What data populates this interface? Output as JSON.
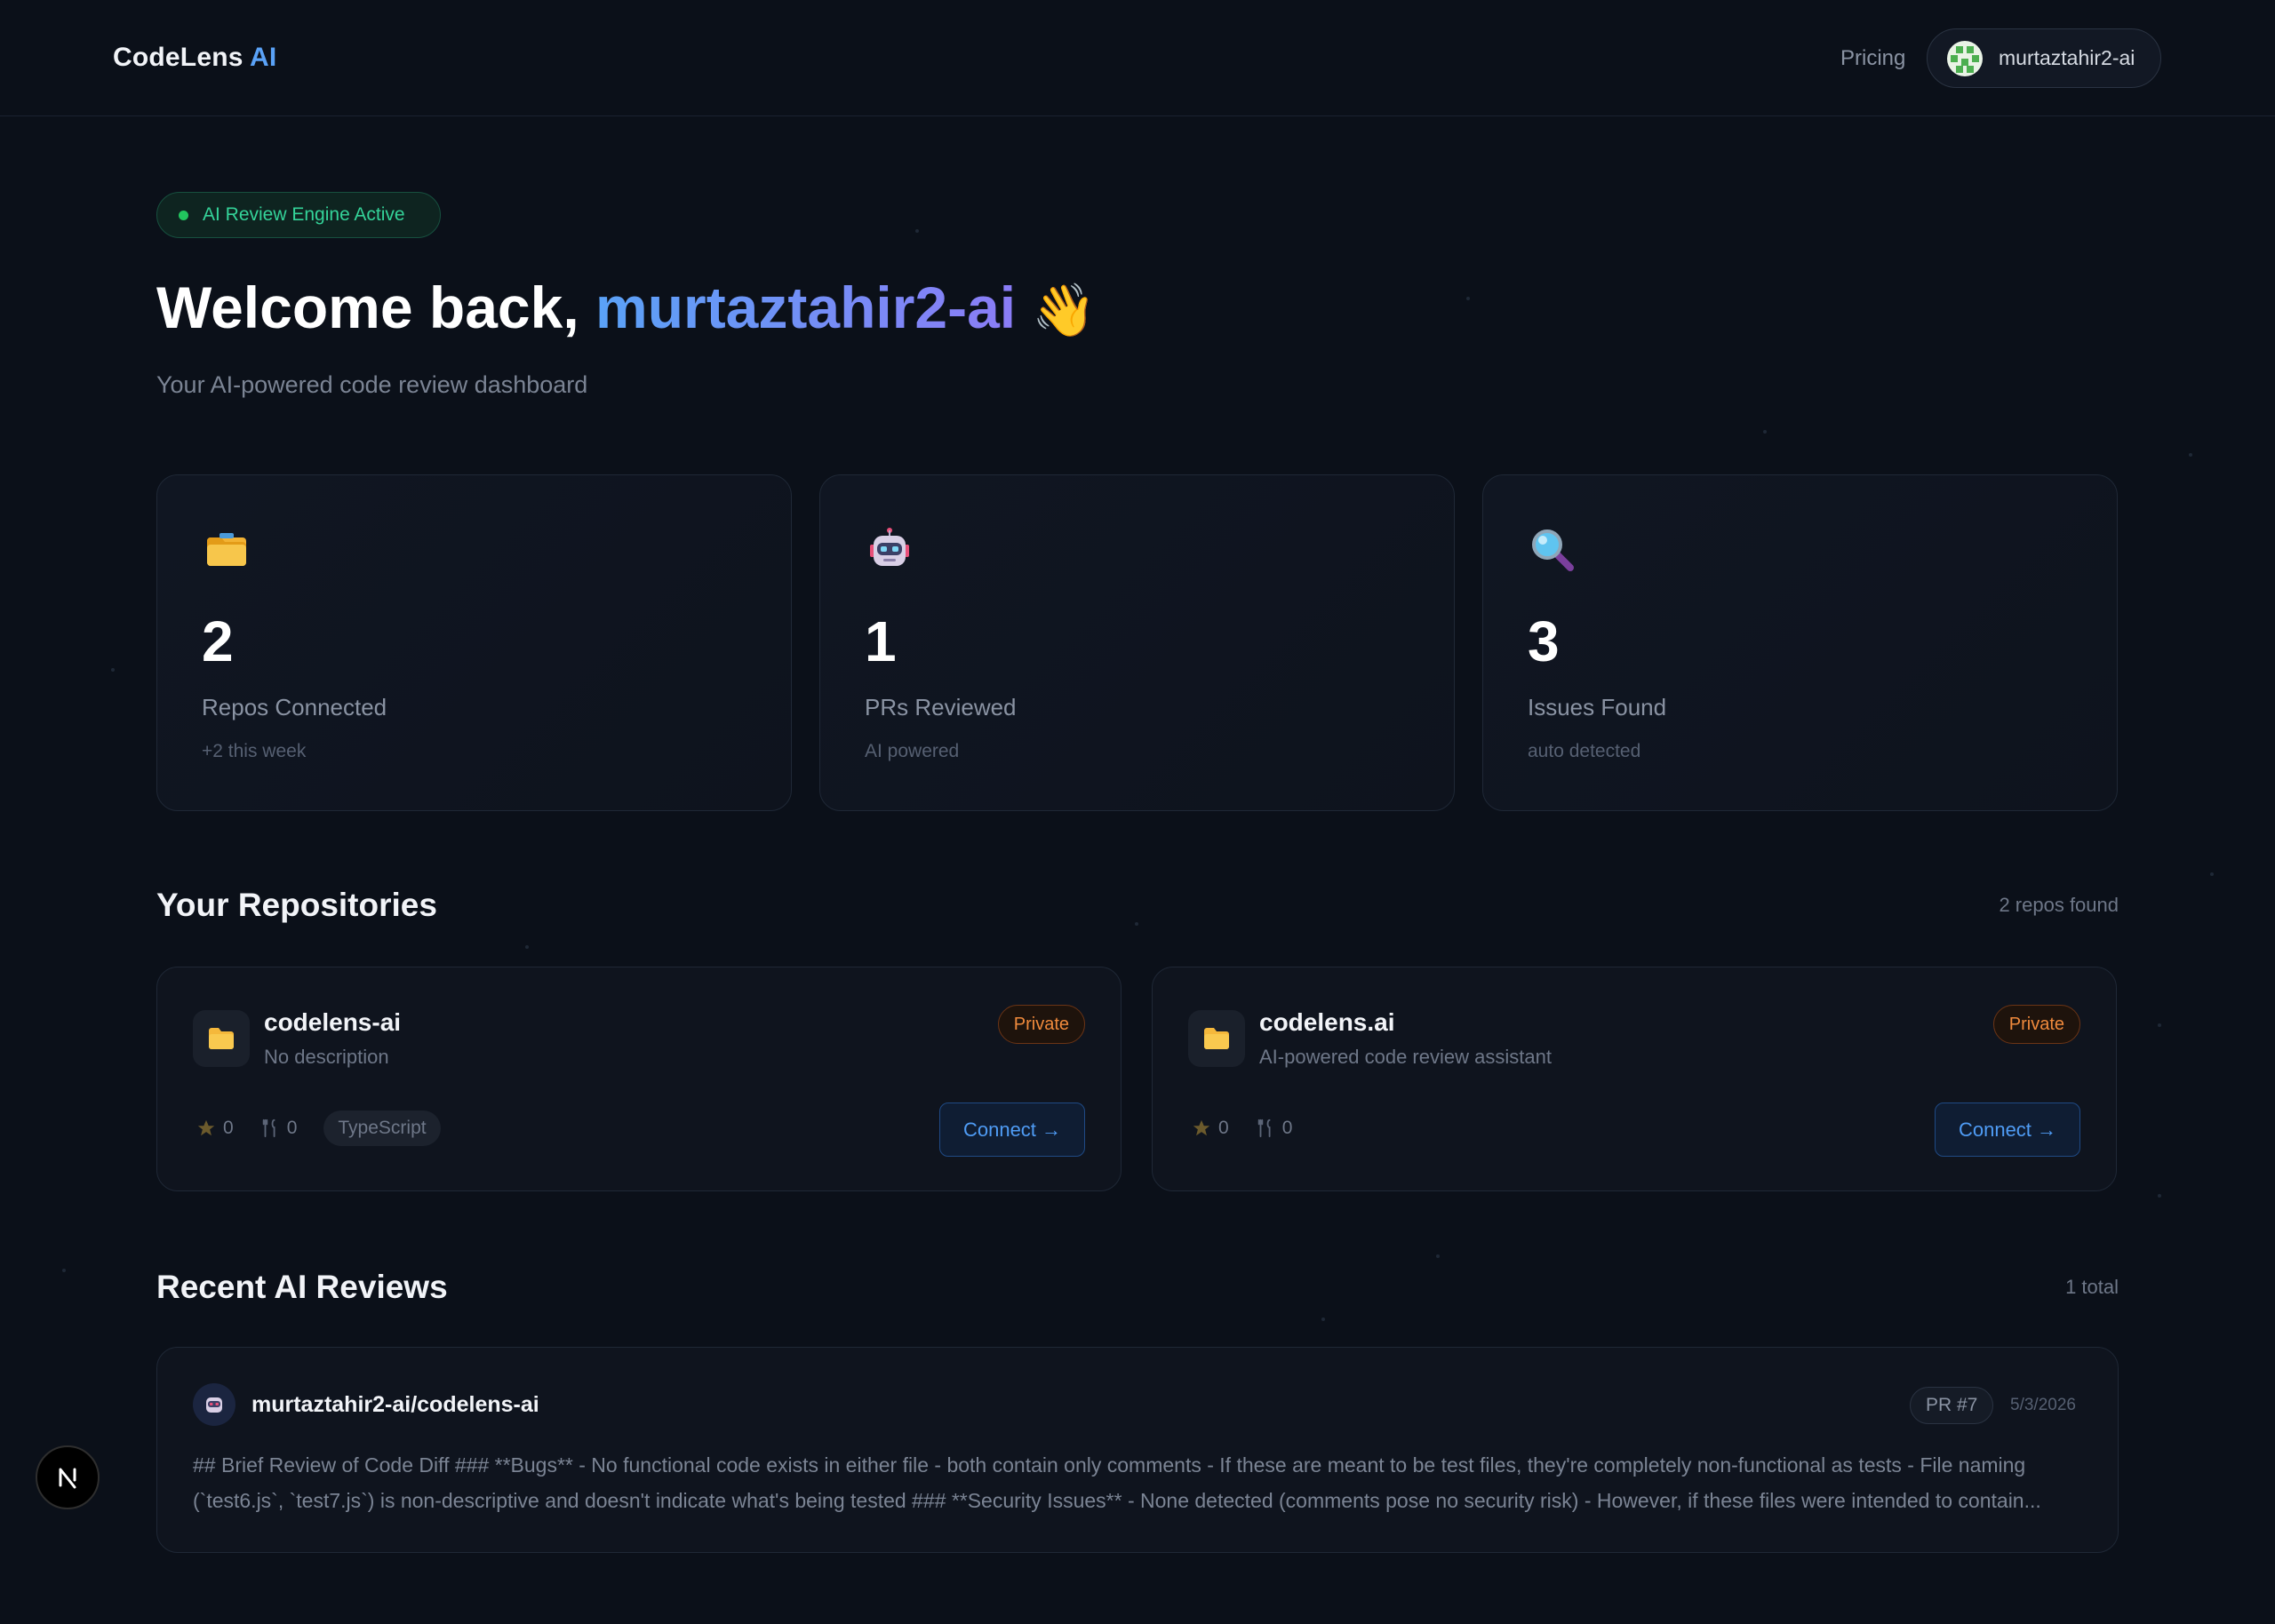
{
  "header": {
    "logo_main": "CodeLens",
    "logo_accent": "AI",
    "nav_pricing": "Pricing",
    "username": "murtaztahir2-ai"
  },
  "hero": {
    "badge": "AI Review Engine Active",
    "welcome_prefix": "Welcome back,",
    "welcome_name": "murtaztahir2-ai",
    "wave": "👋",
    "subtitle": "Your AI-powered code review dashboard"
  },
  "stats": [
    {
      "icon": "folder-icon",
      "value": "2",
      "label": "Repos Connected",
      "note": "+2 this week"
    },
    {
      "icon": "robot-icon",
      "value": "1",
      "label": "PRs Reviewed",
      "note": "AI powered"
    },
    {
      "icon": "magnifier-icon",
      "value": "3",
      "label": "Issues Found",
      "note": "auto detected"
    }
  ],
  "repos_section": {
    "title": "Your Repositories",
    "count": "2 repos found",
    "repos": [
      {
        "name": "codelens-ai",
        "description": "No description",
        "visibility": "Private",
        "stars": "0",
        "forks": "0",
        "language": "TypeScript",
        "connect_label": "Connect →"
      },
      {
        "name": "codelens.ai",
        "description": "AI-powered code review assistant",
        "visibility": "Private",
        "stars": "0",
        "forks": "0",
        "language": "",
        "connect_label": "Connect →"
      }
    ]
  },
  "reviews_section": {
    "title": "Recent AI Reviews",
    "count": "1 total",
    "reviews": [
      {
        "repo": "murtaztahir2-ai/codelens-ai",
        "pr": "PR #7",
        "date": "5/3/2026",
        "body": "## Brief Review of Code Diff ### **Bugs** - No functional code exists in either file - both contain only comments - If these are meant to be test files, they're completely non-functional as tests - File naming (`test6.js`, `test7.js`) is non-descriptive and doesn't indicate what's being tested ### **Security Issues** - None detected (comments pose no security risk) - However, if these files were intended to contain..."
      }
    ]
  },
  "dev_indicator": {
    "label": "N"
  },
  "colors": {
    "background": "#0b1019",
    "accent_blue": "#5aa2f7",
    "accent_purple": "#8b7cf6",
    "success_green": "#22c55e",
    "private_orange": "#f08a3c"
  }
}
